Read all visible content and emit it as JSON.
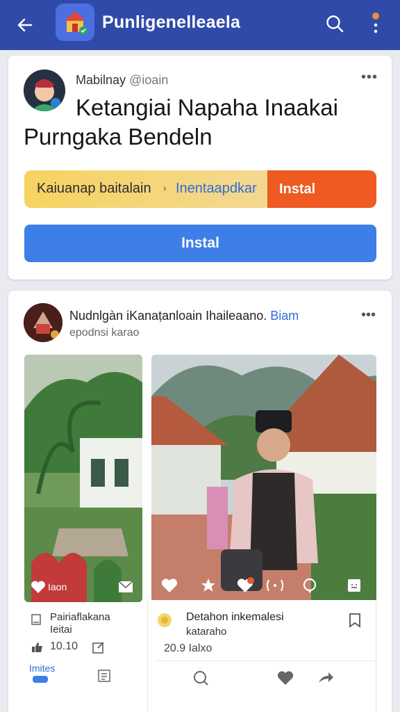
{
  "header": {
    "title": "Punligenelleaela",
    "back_icon": "arrow-left-icon",
    "search_icon": "search-icon",
    "more_icon": "more-vertical-icon"
  },
  "promo_post": {
    "author": "Mabilnay",
    "handle": "@ioain",
    "headline_line1": "Ketangiai Napaha Inaakai",
    "headline_line2": "Purngaka Bendeln",
    "progress": {
      "label": "Kaiuanap baitalain",
      "link": "Inentaapdkar",
      "action": "Instal",
      "fraction": 0.69
    },
    "install_button": "Instal"
  },
  "feed_post": {
    "author": "Nudnlgàn iKanaṭanloain Ihaileaano.",
    "author_tag": "Biam",
    "subtitle": "epodnsi karao",
    "left_photo": {
      "label": "Iaon",
      "caption_line1": "Pairiaflakana",
      "caption_line2": "Ieitai",
      "stat": "10.10",
      "link": "Imites"
    },
    "right_photo": {
      "caption_line1": "Detahon inkemalesi",
      "caption_line2": "kataraho",
      "stat": "20.9 Ialxo"
    }
  },
  "colors": {
    "header_bg": "#2f4aa8",
    "install_orange": "#ee5a22",
    "install_blue": "#3d7fe6",
    "progress_yellow": "#f5cf5a",
    "link_blue": "#2f6cd8"
  }
}
